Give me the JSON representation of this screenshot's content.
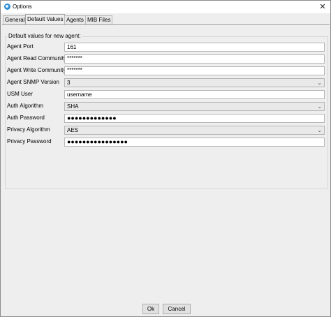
{
  "window": {
    "title": "Options"
  },
  "tabs": [
    {
      "label": "General",
      "active": false
    },
    {
      "label": "Default Values",
      "active": true
    },
    {
      "label": "Agents",
      "active": false
    },
    {
      "label": "MIB Files",
      "active": false
    }
  ],
  "group": {
    "title": "Default values for new agent:"
  },
  "fields": {
    "agent_port": {
      "label": "Agent Port",
      "value": "161"
    },
    "read_community": {
      "label": "Agent Read Community",
      "value": "*******"
    },
    "write_community": {
      "label": "Agent Write Community",
      "value": "*******"
    },
    "snmp_version": {
      "label": "Agent SNMP Version",
      "value": "3"
    },
    "usm_user": {
      "label": "USM User",
      "value": "username"
    },
    "auth_algorithm": {
      "label": "Auth Algorithm",
      "value": "SHA"
    },
    "auth_password": {
      "label": "Auth Password",
      "value": "●●●●●●●●●●●●●"
    },
    "privacy_algorithm": {
      "label": "Privacy Algorithm",
      "value": "AES"
    },
    "privacy_password": {
      "label": "Privacy Password",
      "value": "●●●●●●●●●●●●●●●●"
    }
  },
  "buttons": {
    "ok": "Ok",
    "cancel": "Cancel"
  },
  "icons": {
    "app": "app-logo-icon",
    "close": "close-icon",
    "dropdown": "chevron-down-icon"
  }
}
